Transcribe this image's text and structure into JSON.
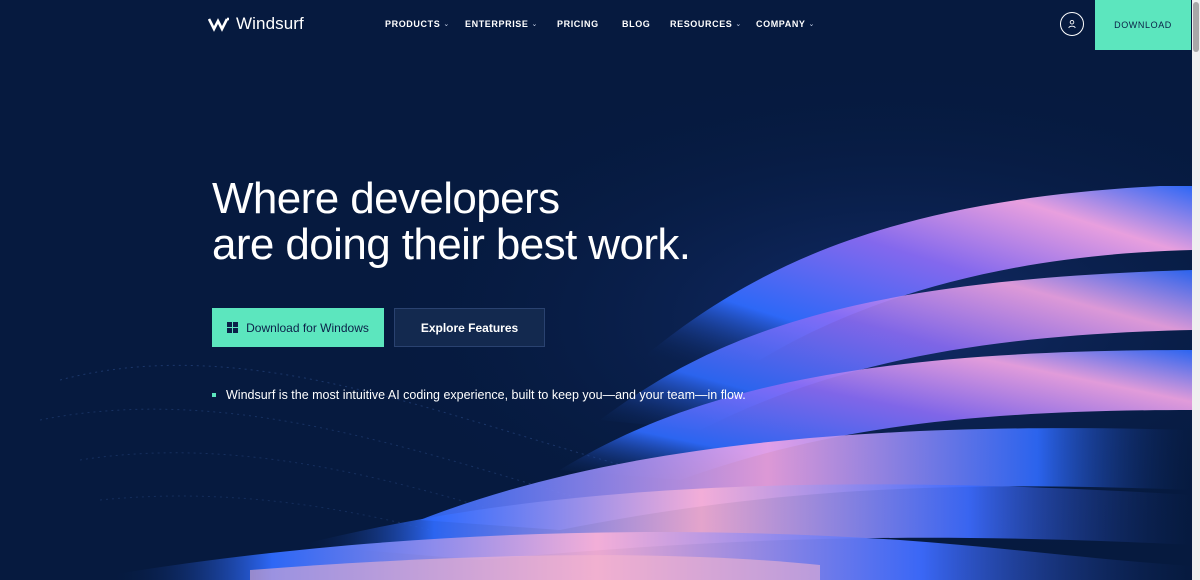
{
  "brand": {
    "name": "Windsurf",
    "logo_icon": "windsurf-wave-icon"
  },
  "nav": {
    "items": [
      {
        "label": "PRODUCTS",
        "has_dropdown": true
      },
      {
        "label": "ENTERPRISE",
        "has_dropdown": true
      },
      {
        "label": "PRICING",
        "has_dropdown": false
      },
      {
        "label": "BLOG",
        "has_dropdown": false
      },
      {
        "label": "RESOURCES",
        "has_dropdown": true
      },
      {
        "label": "COMPANY",
        "has_dropdown": true
      }
    ],
    "dropdown_glyph": "⌄",
    "account_icon": "user-icon",
    "download_label": "DOWNLOAD"
  },
  "hero": {
    "headline_line1": "Where developers",
    "headline_line2": "are doing their best work.",
    "primary_button": "Download for Windows",
    "primary_icon": "windows-logo-icon",
    "secondary_button": "Explore Features",
    "tagline": "Windsurf is the most intuitive AI coding experience, built to keep you—and your team—in flow."
  },
  "colors": {
    "background": "#061a3f",
    "accent": "#5ce6be",
    "wave_blue": "#2f6bff",
    "wave_pink": "#f4a6e6",
    "wave_violet": "#8a6cf5"
  }
}
